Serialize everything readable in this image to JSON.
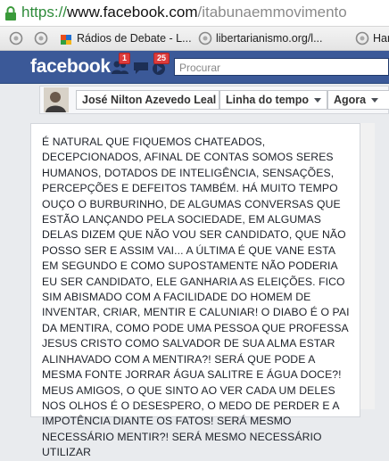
{
  "browser": {
    "url": {
      "protocol": "https://",
      "host": "www.facebook.com",
      "path": "/itabunaemmovimento"
    },
    "bookmarks": [
      {
        "label": "",
        "icon": "globe-icon"
      },
      {
        "label": "",
        "icon": "globe-icon"
      },
      {
        "label": "Rádios de Debate - L...",
        "icon": "puzzle-icon"
      },
      {
        "label": "libertarianismo.org/l...",
        "icon": "globe-icon"
      },
      {
        "label": "Har",
        "icon": "globe-icon"
      }
    ]
  },
  "facebook": {
    "logo": "facebook",
    "friend_requests_count": "1",
    "notifications_count": "25",
    "search_placeholder": "Procurar",
    "brand_color": "#3b5998"
  },
  "timeline_nav": {
    "name": "José Nilton Azevedo Leal",
    "section": "Linha do tempo",
    "period": "Agora"
  },
  "post": {
    "text": "É NATURAL QUE FIQUEMOS CHATEADOS, DECEPCIONADOS, AFINAL DE CONTAS SOMOS SERES HUMANOS, DOTADOS DE INTELIGÊNCIA, SENSAÇÕES, PERCEPÇÕES E DEFEITOS TAMBÉM. HÁ MUITO TEMPO OUÇO O BURBURINHO, DE ALGUMAS CONVERSAS QUE ESTÃO LANÇANDO PELA SOCIEDADE, EM ALGUMAS DELAS DIZEM QUE NÃO VOU SER CANDIDATO, QUE NÃO POSSO SER E ASSIM VAI... A ÚLTIMA É QUE VANE ESTA EM SEGUNDO E COMO SUPOSTAMENTE NÃO PODERIA EU SER CANDIDATO, ELE GANHARIA AS ELEIÇÕES. FICO SIM ABISMADO COM A FACILIDADE DO HOMEM DE INVENTAR, CRIAR, MENTIR E CALUNIAR! O DIABO É O PAI DA MENTIRA, COMO PODE UMA PESSOA QUE PROFESSA JESUS CRISTO COMO SALVADOR DE SUA ALMA ESTAR ALINHAVADO COM A MENTIRA?! SERÁ QUE PODE A MESMA FONTE JORRAR ÁGUA SALITRE E ÁGUA DOCE?! MEUS AMIGOS, O QUE SINTO AO VER CADA UM DELES NOS OLHOS É O DESESPERO, O MEDO DE PERDER E A IMPOTÊNCIA DIANTE OS FATOS! SERÁ MESMO NECESSÁRIO MENTIR?! SERÁ MESMO NECESSÁRIO UTILIZAR"
  }
}
